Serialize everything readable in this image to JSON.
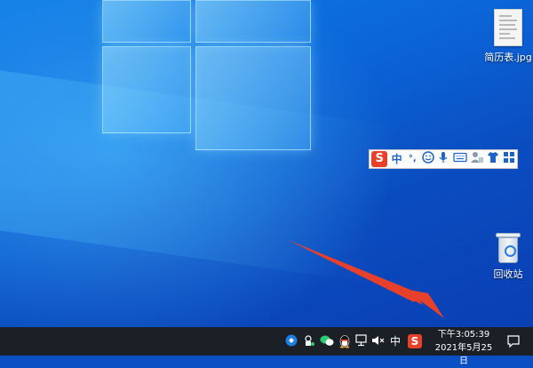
{
  "desktop": {
    "icons": [
      {
        "label": "简历表.jpg",
        "icon": "image-file-icon"
      },
      {
        "label": "回收站",
        "icon": "recycle-bin-icon"
      }
    ]
  },
  "ime_toolbar": {
    "logo": "S",
    "mode": "中",
    "punctuation": "°,",
    "buttons": [
      "emoji-icon",
      "microphone-icon",
      "keyboard-icon",
      "user-icon",
      "skin-shirt-icon",
      "toolbox-grid-icon"
    ]
  },
  "taskbar": {
    "tray_icons": [
      "sogou-cloud-icon",
      "usb-device-icon",
      "wechat-icon",
      "qq-penguin-icon",
      "network-icon",
      "volume-muted-icon"
    ],
    "ime_indicator": "中",
    "ime_logo": "S",
    "clock": {
      "time": "下午3:05:39",
      "date": "2021年5月25日"
    }
  },
  "colors": {
    "annotation_arrow": "#e8412b",
    "taskbar": "#1b1f26",
    "ime_logo": "#e8412b"
  }
}
